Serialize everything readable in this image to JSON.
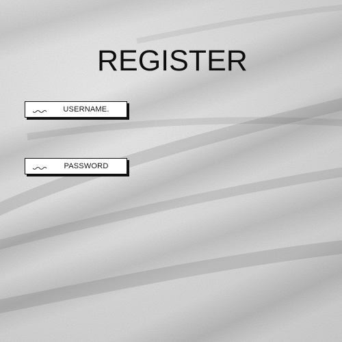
{
  "title": "REGISTER",
  "fields": {
    "username": {
      "label": "USERNAME.",
      "icon": "squiggle-icon"
    },
    "password": {
      "label": "PASSWORD",
      "icon": "squiggle-icon"
    }
  },
  "colors": {
    "background": "#d9d9d9",
    "field_fill": "#ffffff",
    "ink": "#111111"
  }
}
